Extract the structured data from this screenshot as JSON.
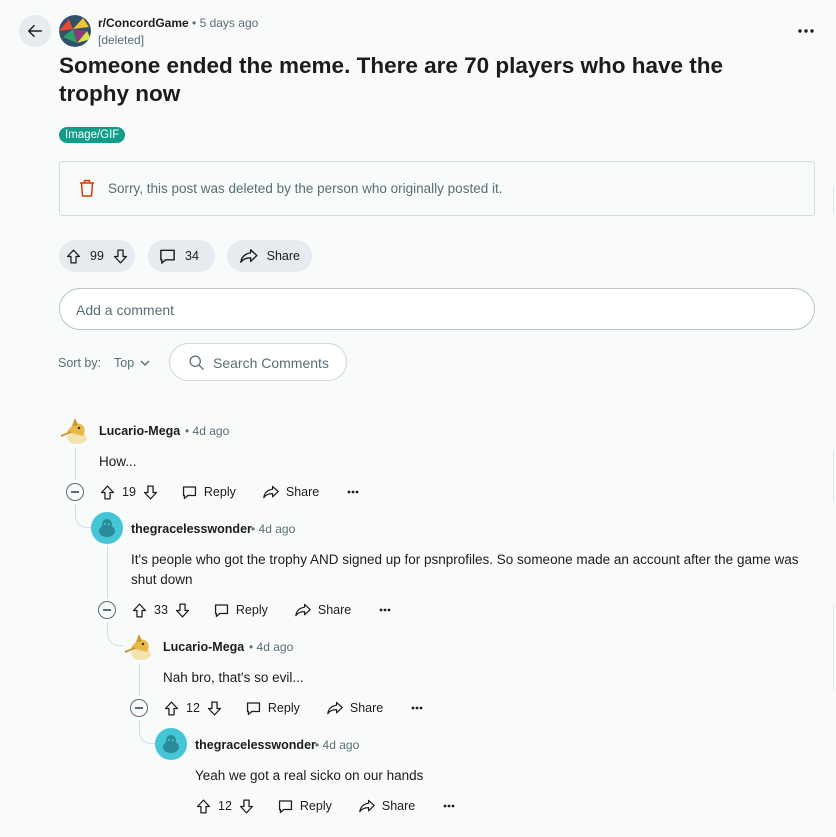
{
  "post": {
    "subreddit": "r/ConcordGame",
    "separator": "•",
    "posted": "5 days ago",
    "author": "[deleted]",
    "title": "Someone ended the meme. There are 70 players who have the trophy now",
    "flair": "Image/GIF",
    "deleted_message": "Sorry, this post was deleted by the person who originally posted it.",
    "score": "99",
    "comment_count": "34",
    "share_label": "Share"
  },
  "comment_box": {
    "placeholder": "Add a comment"
  },
  "sort": {
    "label": "Sort by:",
    "value": "Top"
  },
  "search": {
    "placeholder": "Search Comments"
  },
  "comments": [
    {
      "author": "Lucario-Mega",
      "time": "• 4d ago",
      "body": "How...",
      "score": "19",
      "reply": "Reply",
      "share": "Share"
    },
    {
      "author": "thegracelesswonder",
      "time": "• 4d ago",
      "body": "It's people who got the trophy AND signed up for psnprofiles. So someone made an account after the game was shut down",
      "score": "33",
      "reply": "Reply",
      "share": "Share"
    },
    {
      "author": "Lucario-Mega",
      "time": "• 4d ago",
      "body": "Nah bro, that's so evil...",
      "score": "12",
      "reply": "Reply",
      "share": "Share"
    },
    {
      "author": "thegracelesswonder",
      "time": "• 4d ago",
      "body": "Yeah we got a real sicko on our hands",
      "score": "12",
      "reply": "Reply",
      "share": "Share"
    }
  ],
  "icons": {
    "back": "arrow-left-icon",
    "more": "ellipsis-icon",
    "trash": "trash-icon",
    "upvote": "upvote-arrow-icon",
    "downvote": "downvote-arrow-icon",
    "comment": "speech-bubble-icon",
    "share": "share-arrow-icon",
    "search": "magnifier-icon",
    "collapse": "minus-circle-icon"
  },
  "colors": {
    "background": "#f9fafa",
    "pill": "#e5ebee",
    "flair": "#0f9d8a",
    "trash": "#d93a00",
    "snoo": "#45c6d6",
    "muted_text": "#576f76"
  }
}
